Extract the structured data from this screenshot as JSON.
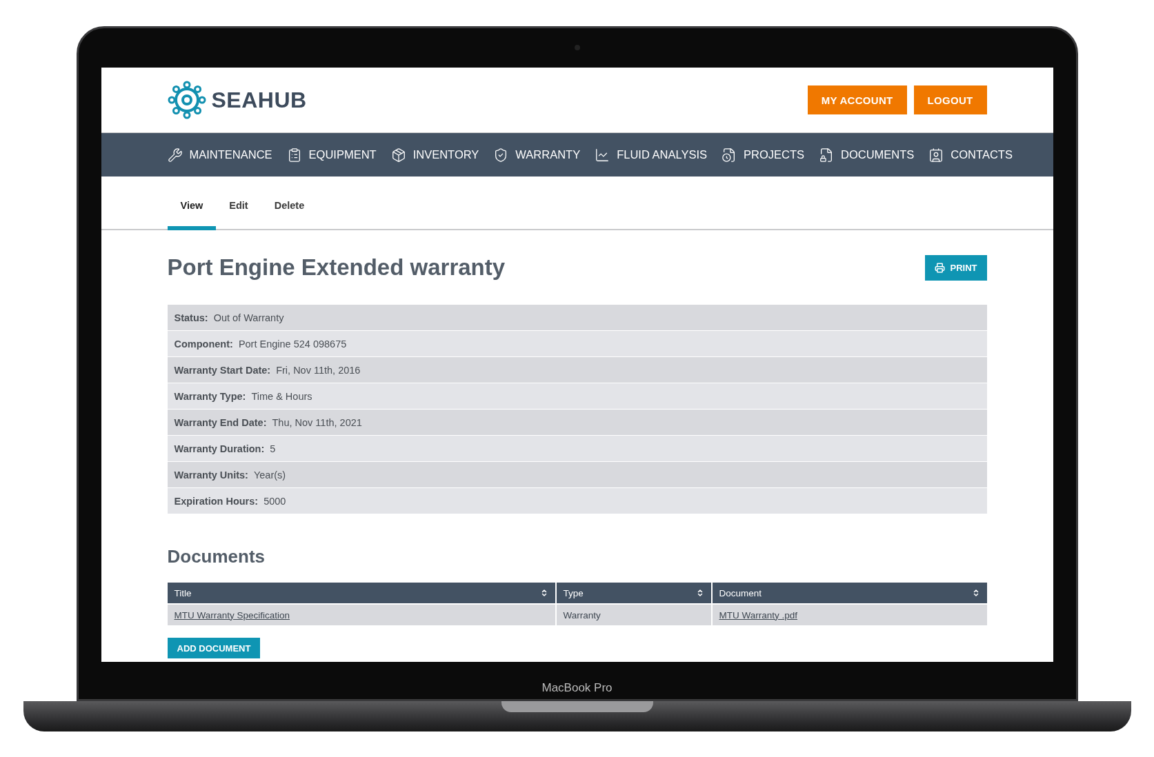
{
  "header": {
    "logo_text": "SEAHUB",
    "buttons": [
      "MY ACCOUNT",
      "LOGOUT"
    ]
  },
  "nav": [
    {
      "label": "MAINTENANCE",
      "kind": "tools"
    },
    {
      "label": "EQUIPMENT",
      "kind": "clipboard"
    },
    {
      "label": "INVENTORY",
      "kind": "cart"
    },
    {
      "label": "WARRANTY",
      "kind": "shield"
    },
    {
      "label": "FLUID ANALYSIS",
      "kind": "chart"
    },
    {
      "label": "PROJECTS",
      "kind": "fileclock"
    },
    {
      "label": "DOCUMENTS",
      "kind": "filelock"
    },
    {
      "label": "CONTACTS",
      "kind": "contact"
    }
  ],
  "tabs": [
    {
      "label": "View",
      "selected": true
    },
    {
      "label": "Edit",
      "selected": false
    },
    {
      "label": "Delete",
      "selected": false
    }
  ],
  "title": "Port Engine Extended warranty",
  "print_button": "PRINT",
  "details": [
    {
      "label": "Status:",
      "value": "Out of Warranty"
    },
    {
      "label": "Component:",
      "value": "Port Engine 524 098675"
    },
    {
      "label": "Warranty Start Date:",
      "value": "Fri, Nov 11th, 2016"
    },
    {
      "label": "Warranty Type:",
      "value": "Time & Hours"
    },
    {
      "label": "Warranty End Date:",
      "value": "Thu, Nov 11th, 2021"
    },
    {
      "label": "Warranty Duration:",
      "value": "5"
    },
    {
      "label": "Warranty Units:",
      "value": "Year(s)"
    },
    {
      "label": "Expiration Hours:",
      "value": "5000"
    }
  ],
  "documents": {
    "heading": "Documents",
    "columns": [
      "Title",
      "Type",
      "Document"
    ],
    "rows": [
      [
        {
          "text": "MTU Warranty Specification",
          "kind": "link"
        },
        {
          "text": "Warranty",
          "kind": "text"
        },
        {
          "text": "MTU Warranty .pdf",
          "kind": "link"
        }
      ]
    ],
    "add_button": "ADD DOCUMENT"
  },
  "device_label": "MacBook Pro"
}
